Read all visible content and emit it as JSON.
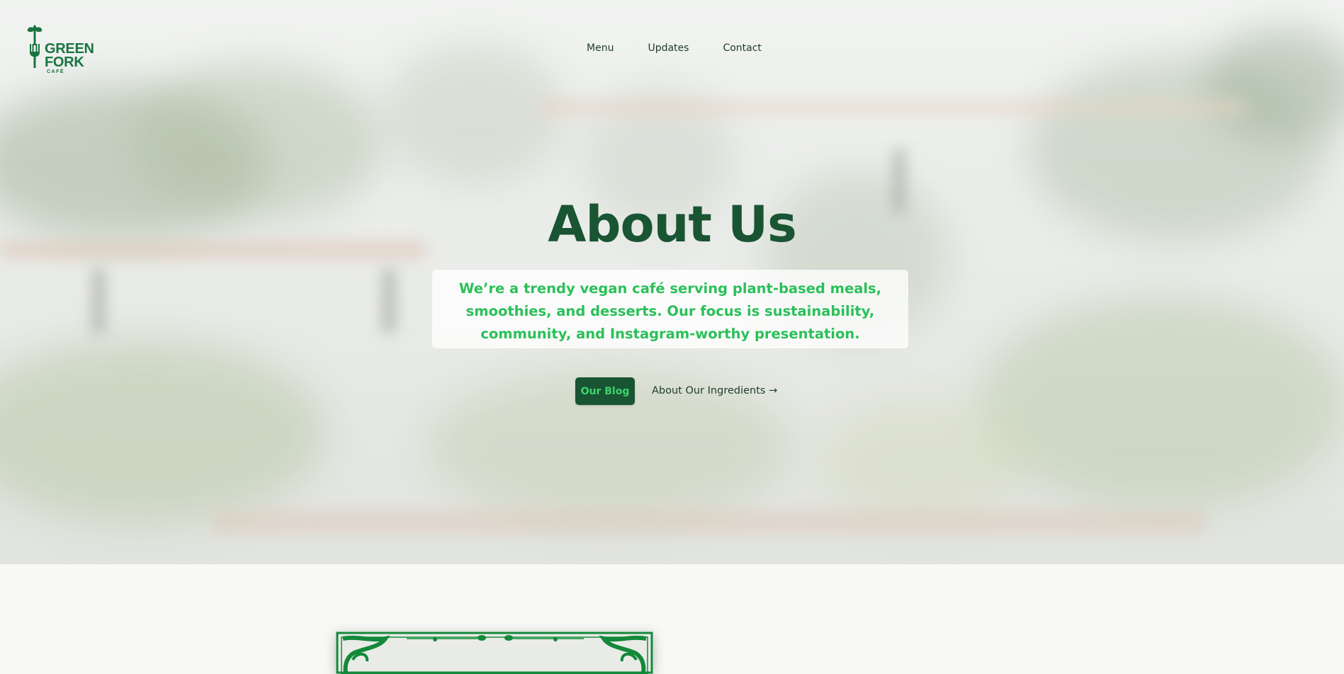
{
  "brand": {
    "name_line1": "GREEN",
    "name_line2": "FORK",
    "sub": "CAFÉ",
    "color": "#19743f"
  },
  "nav": {
    "items": [
      {
        "label": "Menu"
      },
      {
        "label": "Updates"
      },
      {
        "label": "Contact"
      }
    ]
  },
  "hero": {
    "title": "About Us",
    "description": "We’re a trendy vegan café serving plant-based meals, smoothies, and desserts. Our focus is sustainability, community, and Instagram-worthy presentation.",
    "primary_button": "Our Blog",
    "secondary_link": "About Our Ingredients →"
  },
  "colors": {
    "primary_dark": "#195433",
    "accent_green": "#2bc05a",
    "text_dark": "#1c3d2b"
  },
  "icons": {
    "logo": "fork-sprout-icon",
    "frame_ornament": "ornamental-frame"
  }
}
